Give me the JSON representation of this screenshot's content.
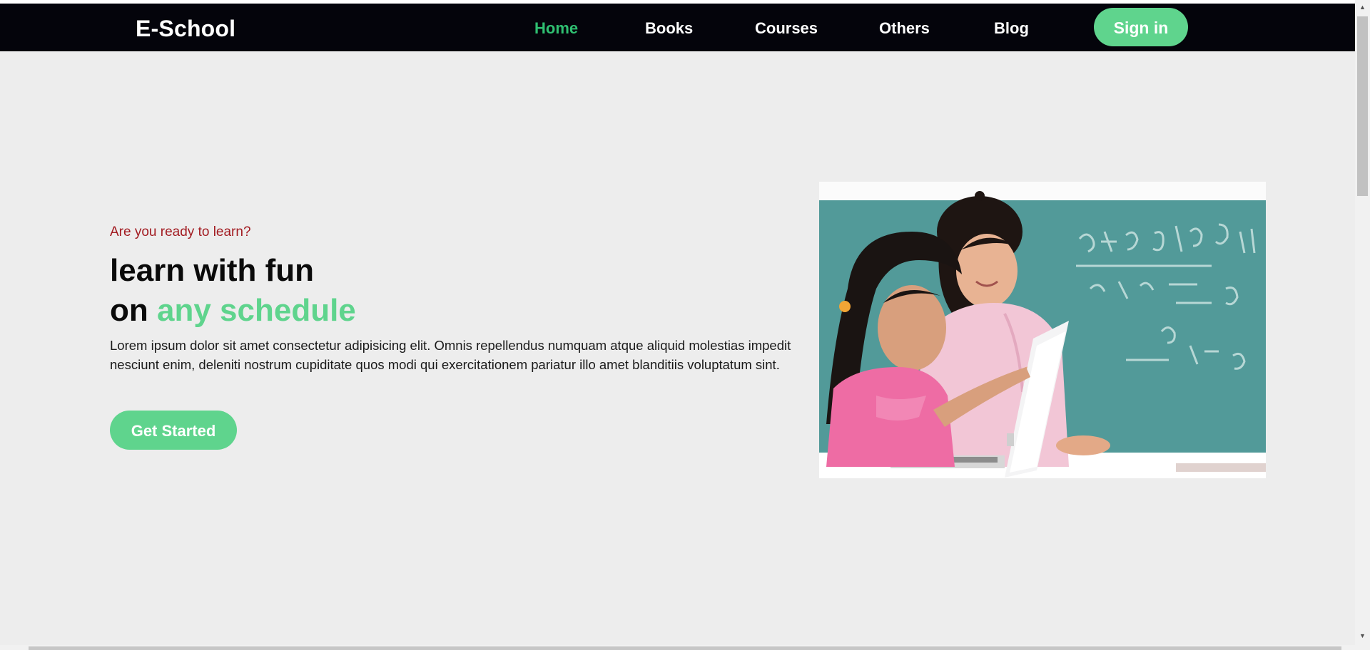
{
  "nav": {
    "brand": "E-School",
    "links": [
      {
        "label": "Home",
        "active": true
      },
      {
        "label": "Books",
        "active": false
      },
      {
        "label": "Courses",
        "active": false
      },
      {
        "label": "Others",
        "active": false
      },
      {
        "label": "Blog",
        "active": false
      }
    ],
    "signin_label": "Sign in"
  },
  "hero": {
    "eyebrow": "Are you ready to learn?",
    "headline_line1": "learn with fun",
    "headline_line2_prefix": "on",
    "headline_line2_accent": "any schedule",
    "paragraph": "Lorem ipsum dolor sit amet consectetur adipisicing elit. Omnis repellendus numquam atque aliquid molestias impedit nesciunt enim, deleniti nostrum cupiditate quos modi qui exercitationem pariatur illo amet blanditiis voluptatum sint.",
    "cta_label": "Get Started",
    "image_icon": "teacher-and-student-with-laptop-photo"
  },
  "colors": {
    "nav_bg": "#04040b",
    "accent": "#5fd48d",
    "active_link": "#2fbf71",
    "eyebrow": "#a21b21",
    "page_bg": "#ededed"
  }
}
